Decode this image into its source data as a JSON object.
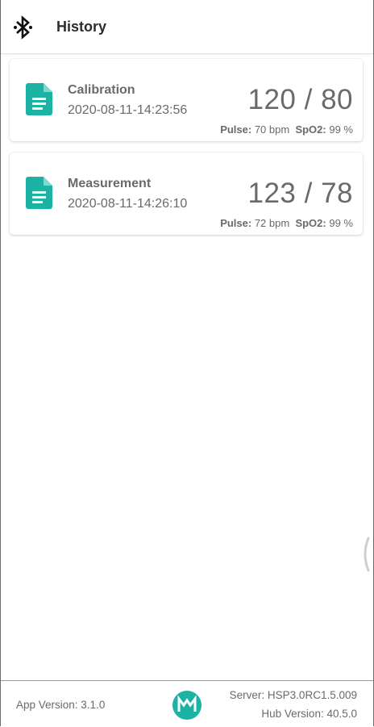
{
  "header": {
    "title": "History",
    "icon": "bluetooth-icon"
  },
  "records": [
    {
      "type": "Calibration",
      "timestamp": "2020-08-11-14:23:56",
      "bp": "120 / 80",
      "pulse_label": "Pulse:",
      "pulse_value": "70 bpm",
      "spo2_label": "SpO2:",
      "spo2_value": "99 %"
    },
    {
      "type": "Measurement",
      "timestamp": "2020-08-11-14:26:10",
      "bp": "123 / 78",
      "pulse_label": "Pulse:",
      "pulse_value": "72 bpm",
      "spo2_label": "SpO2:",
      "spo2_value": "99 %"
    }
  ],
  "footer": {
    "app_version": "App Version: 3.1.0",
    "server": "Server: HSP3.0RC1.5.009",
    "hub_version": "Hub Version: 40.5.0",
    "logo": "maxim-logo"
  },
  "colors": {
    "accent": "#1db3a4",
    "text": "#6a6a6a",
    "title": "#2c2c2c"
  }
}
